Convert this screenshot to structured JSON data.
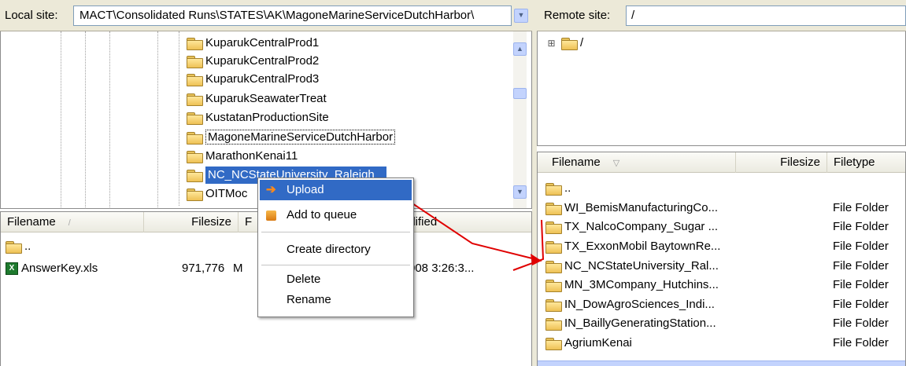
{
  "local": {
    "label": "Local site:",
    "path": "MACT\\Consolidated Runs\\STATES\\AK\\MagoneMarineServiceDutchHarbor\\",
    "tree": [
      "KuparukCentralProd1",
      "KuparukCentralProd2",
      "KuparukCentralProd3",
      "KuparukSeawaterTreat",
      "KustatanProductionSite",
      "MagoneMarineServiceDutchHarbor",
      "MarathonKenai11",
      "NC_NCStateUniversity_Raleigh",
      "OITMoc"
    ],
    "headers": {
      "filename": "Filename",
      "filesize": "Filesize",
      "filetype": "F",
      "modified": "odified"
    },
    "files": [
      {
        "name": "..",
        "size": "",
        "type": "",
        "modified": ""
      },
      {
        "name": "AnswerKey.xls",
        "size": "971,776",
        "type": "M",
        "modified": "008 3:26:3..."
      }
    ]
  },
  "remote": {
    "label": "Remote site:",
    "path": "/",
    "tree_root": "/",
    "tree_expander": "⊞",
    "headers": {
      "filename": "Filename",
      "filesize": "Filesize",
      "filetype": "Filetype"
    },
    "files": [
      {
        "name": "..",
        "type": ""
      },
      {
        "name": "WI_BemisManufacturingCo...",
        "type": "File Folder"
      },
      {
        "name": "TX_NalcoCompany_Sugar ...",
        "type": "File Folder"
      },
      {
        "name": "TX_ExxonMobil BaytownRe...",
        "type": "File Folder"
      },
      {
        "name": "NC_NCStateUniversity_Ral...",
        "type": "File Folder"
      },
      {
        "name": "MN_3MCompany_Hutchins...",
        "type": "File Folder"
      },
      {
        "name": "IN_DowAgroSciences_Indi...",
        "type": "File Folder"
      },
      {
        "name": "IN_BaillyGeneratingStation...",
        "type": "File Folder"
      },
      {
        "name": "AgriumKenai",
        "type": "File Folder"
      }
    ]
  },
  "menu": {
    "upload": "Upload",
    "add_queue": "Add to queue",
    "create_dir": "Create directory",
    "delete": "Delete",
    "rename": "Rename"
  },
  "colors": {
    "selection": "#316ac5",
    "arrow": "#e00000",
    "menu_highlight": "#316ac5"
  }
}
